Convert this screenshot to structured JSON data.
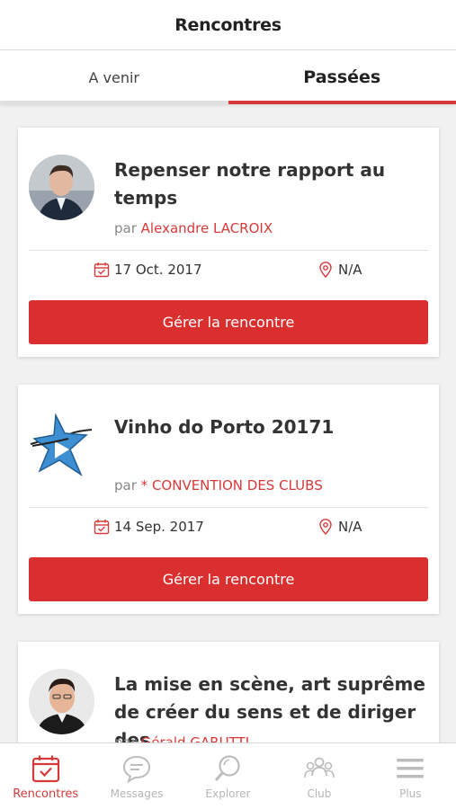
{
  "header": {
    "title": "Rencontres"
  },
  "tabs": [
    {
      "label": "A venir",
      "active": false
    },
    {
      "label": "Passées",
      "active": true
    }
  ],
  "accent_color": "#d63a3a",
  "events": [
    {
      "title": "Repenser notre rapport au temps",
      "by_prefix": "par",
      "organizer": "Alexandre LACROIX",
      "date": "17 Oct. 2017",
      "location": "N/A",
      "button": "Gérer la rencontre",
      "avatar_icon": "person-photo"
    },
    {
      "title": "Vinho do Porto 20171",
      "by_prefix": "par",
      "organizer": "* CONVENTION DES CLUBS",
      "date": "14 Sep. 2017",
      "location": "N/A",
      "button": "Gérer la rencontre",
      "avatar_icon": "star-play-logo"
    },
    {
      "title": "La mise en scène, art suprême de créer du sens et de diriger des",
      "by_prefix": "par",
      "organizer": "Gérald GARUTTI",
      "avatar_icon": "person-photo"
    }
  ],
  "nav": [
    {
      "label": "Rencontres",
      "icon": "calendar-check-icon",
      "active": true
    },
    {
      "label": "Messages",
      "icon": "chat-bubble-icon",
      "active": false
    },
    {
      "label": "Explorer",
      "icon": "search-icon",
      "active": false
    },
    {
      "label": "Club",
      "icon": "group-icon",
      "active": false
    },
    {
      "label": "Plus",
      "icon": "menu-icon",
      "active": false
    }
  ]
}
